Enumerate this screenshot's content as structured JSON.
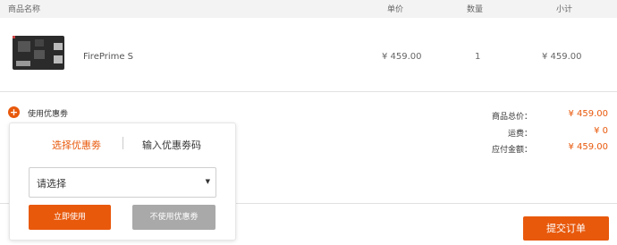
{
  "header": {
    "col_name": "商品名称",
    "col_price": "单价",
    "col_qty": "数量",
    "col_subtotal": "小计"
  },
  "product": {
    "image_icon": "dev-board-thumbnail",
    "name": "FirePrime S",
    "price": "¥ 459.00",
    "qty": "1",
    "subtotal": "¥ 459.00"
  },
  "coupon": {
    "toggle_icon": "plus-icon",
    "toggle_label": "使用优惠劵",
    "tab_select": "选择优惠劵",
    "tab_input": "输入优惠劵码",
    "select_value": "请选择",
    "apply_label": "立即使用",
    "no_coupon_label": "不使用优惠劵"
  },
  "summary": {
    "subtotal_label": "商品总价：",
    "subtotal_value": "¥ 459.00",
    "shipping_label": "运费：",
    "shipping_value": "¥ 0",
    "total_label": "应付金额：",
    "total_value": "¥ 459.00"
  },
  "actions": {
    "submit_label": "提交订单"
  },
  "colors": {
    "accent": "#e8590c",
    "disabled": "#a9a9a9",
    "header_bg": "#f3f3f3"
  }
}
